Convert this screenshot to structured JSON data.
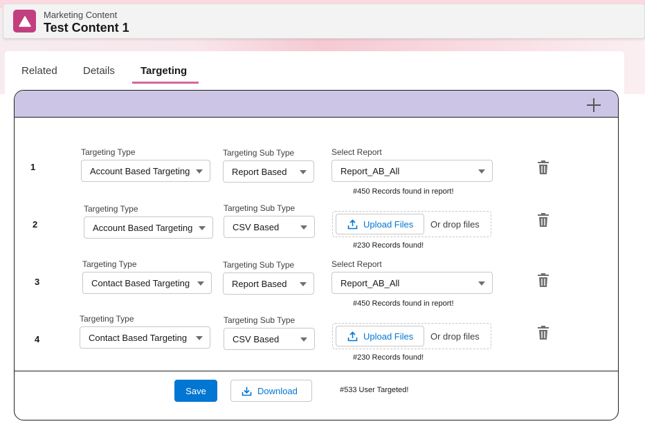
{
  "header": {
    "eyebrow": "Marketing Content",
    "title": "Test Content 1",
    "icon": "triangle-icon",
    "icon_color": "#c23f7e"
  },
  "tabs": [
    {
      "label": "Related",
      "active": false
    },
    {
      "label": "Details",
      "active": false
    },
    {
      "label": "Targeting",
      "active": true
    }
  ],
  "card": {
    "header_color": "#cdc5e6",
    "add_icon": "plus-icon"
  },
  "rows": [
    {
      "number": "1",
      "targeting_type_label": "Targeting Type",
      "targeting_type": "Account Based Targeting",
      "sub_type_label": "Targeting Sub Type",
      "sub_type": "Report Based",
      "report_label": "Select Report",
      "report": "Report_AB_All",
      "note": "#450 Records found in report!"
    },
    {
      "number": "2",
      "targeting_type_label": "Targeting Type",
      "targeting_type": "Account Based Targeting",
      "sub_type_label": "Targeting Sub Type",
      "sub_type": "CSV Based",
      "upload_label": "Upload Files",
      "drop_label": "Or drop files",
      "note": "#230 Records found!"
    },
    {
      "number": "3",
      "targeting_type_label": "Targeting Type",
      "targeting_type": "Contact Based Targeting",
      "sub_type_label": "Targeting Sub Type",
      "sub_type": "Report Based",
      "report_label": "Select Report",
      "report": "Report_AB_All",
      "note": "#450 Records found in report!"
    },
    {
      "number": "4",
      "targeting_type_label": "Targeting Type",
      "targeting_type": "Contact Based Targeting",
      "sub_type_label": "Targeting Sub Type",
      "sub_type": "CSV Based",
      "upload_label": "Upload Files",
      "drop_label": "Or drop files",
      "note": "#230 Records found!"
    }
  ],
  "footer": {
    "save_label": "Save",
    "download_label": "Download",
    "status": "#533 User Targeted!",
    "brand_color": "#0176d3"
  }
}
